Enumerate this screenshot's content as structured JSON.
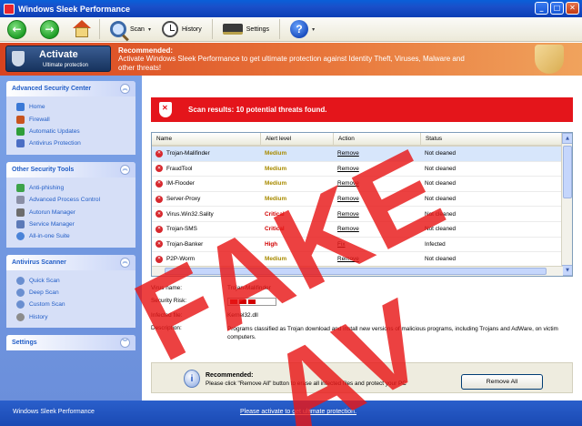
{
  "window": {
    "title": "Windows Sleek Performance"
  },
  "toolbar": {
    "scan_label": "Scan",
    "history_label": "History",
    "settings_label": "Settings"
  },
  "banner": {
    "activate_label": "Activate",
    "activate_sub": "Ultimate protection",
    "rec_title": "Recommended:",
    "rec_text": "Activate Windows Sleek Performance to get ultimate protection against Identity Theft, Viruses, Malware and other threats!"
  },
  "sidebar": {
    "panels": [
      {
        "title": "Advanced Security Center",
        "items": [
          "Home",
          "Firewall",
          "Automatic Updates",
          "Antivirus Protection"
        ]
      },
      {
        "title": "Other Security Tools",
        "items": [
          "Anti-phishing",
          "Advanced Process Control",
          "Autorun Manager",
          "Service Manager",
          "All-in-one Suite"
        ]
      },
      {
        "title": "Antivirus Scanner",
        "items": [
          "Quick Scan",
          "Deep Scan",
          "Custom Scan",
          "History"
        ]
      },
      {
        "title": "Settings",
        "items": []
      }
    ]
  },
  "scan": {
    "result_text": "Scan results: 10 potential threats found.",
    "columns": [
      "Name",
      "Alert level",
      "Action",
      "Status"
    ],
    "rows": [
      {
        "name": "Trojan-Malifinder",
        "level": "Medium",
        "action": "Remove",
        "status": "Not cleaned"
      },
      {
        "name": "FraudTool",
        "level": "Medium",
        "action": "Remove",
        "status": "Not cleaned"
      },
      {
        "name": "IM-Flooder",
        "level": "Medium",
        "action": "Remove",
        "status": "Not cleaned"
      },
      {
        "name": "Server-Proxy",
        "level": "Medium",
        "action": "Remove",
        "status": "Not cleaned"
      },
      {
        "name": "Virus.Win32.Sality",
        "level": "Critical",
        "action": "Remove",
        "status": "Not cleaned"
      },
      {
        "name": "Trojan-SMS",
        "level": "Critical",
        "action": "Remove",
        "status": "Not cleaned"
      },
      {
        "name": "Trojan-Banker",
        "level": "High",
        "action": "Fix",
        "status": "Infected"
      },
      {
        "name": "P2P-Worm",
        "level": "Medium",
        "action": "Remove",
        "status": "Not cleaned"
      }
    ]
  },
  "details": {
    "virus_label": "Virus name:",
    "virus_value": "Trojan-Malifinder",
    "risk_label": "Security Risk:",
    "risk_level": 3,
    "file_label": "Infected file:",
    "file_value": "Kernel32.dll",
    "desc_label": "Description:",
    "desc_value": "Programs classified as Trojan download and install new versions of malicious programs, including Trojans and AdWare, on victim computers."
  },
  "recommend": {
    "title": "Recommended:",
    "text": "Please click \"Remove All\" button to erase all infected files and protect your PC",
    "button": "Remove All"
  },
  "statusbar": {
    "left": "Windows Sleek Performance",
    "link": "Please activate to get ultimate protection."
  },
  "overlay": {
    "text": "FAKE AV"
  },
  "colors": {
    "alert_red": "#e4151b",
    "sidebar_blue": "#6b8fdb",
    "titlebar_blue": "#0a5fd8",
    "banner_orange": "#e8753a"
  }
}
